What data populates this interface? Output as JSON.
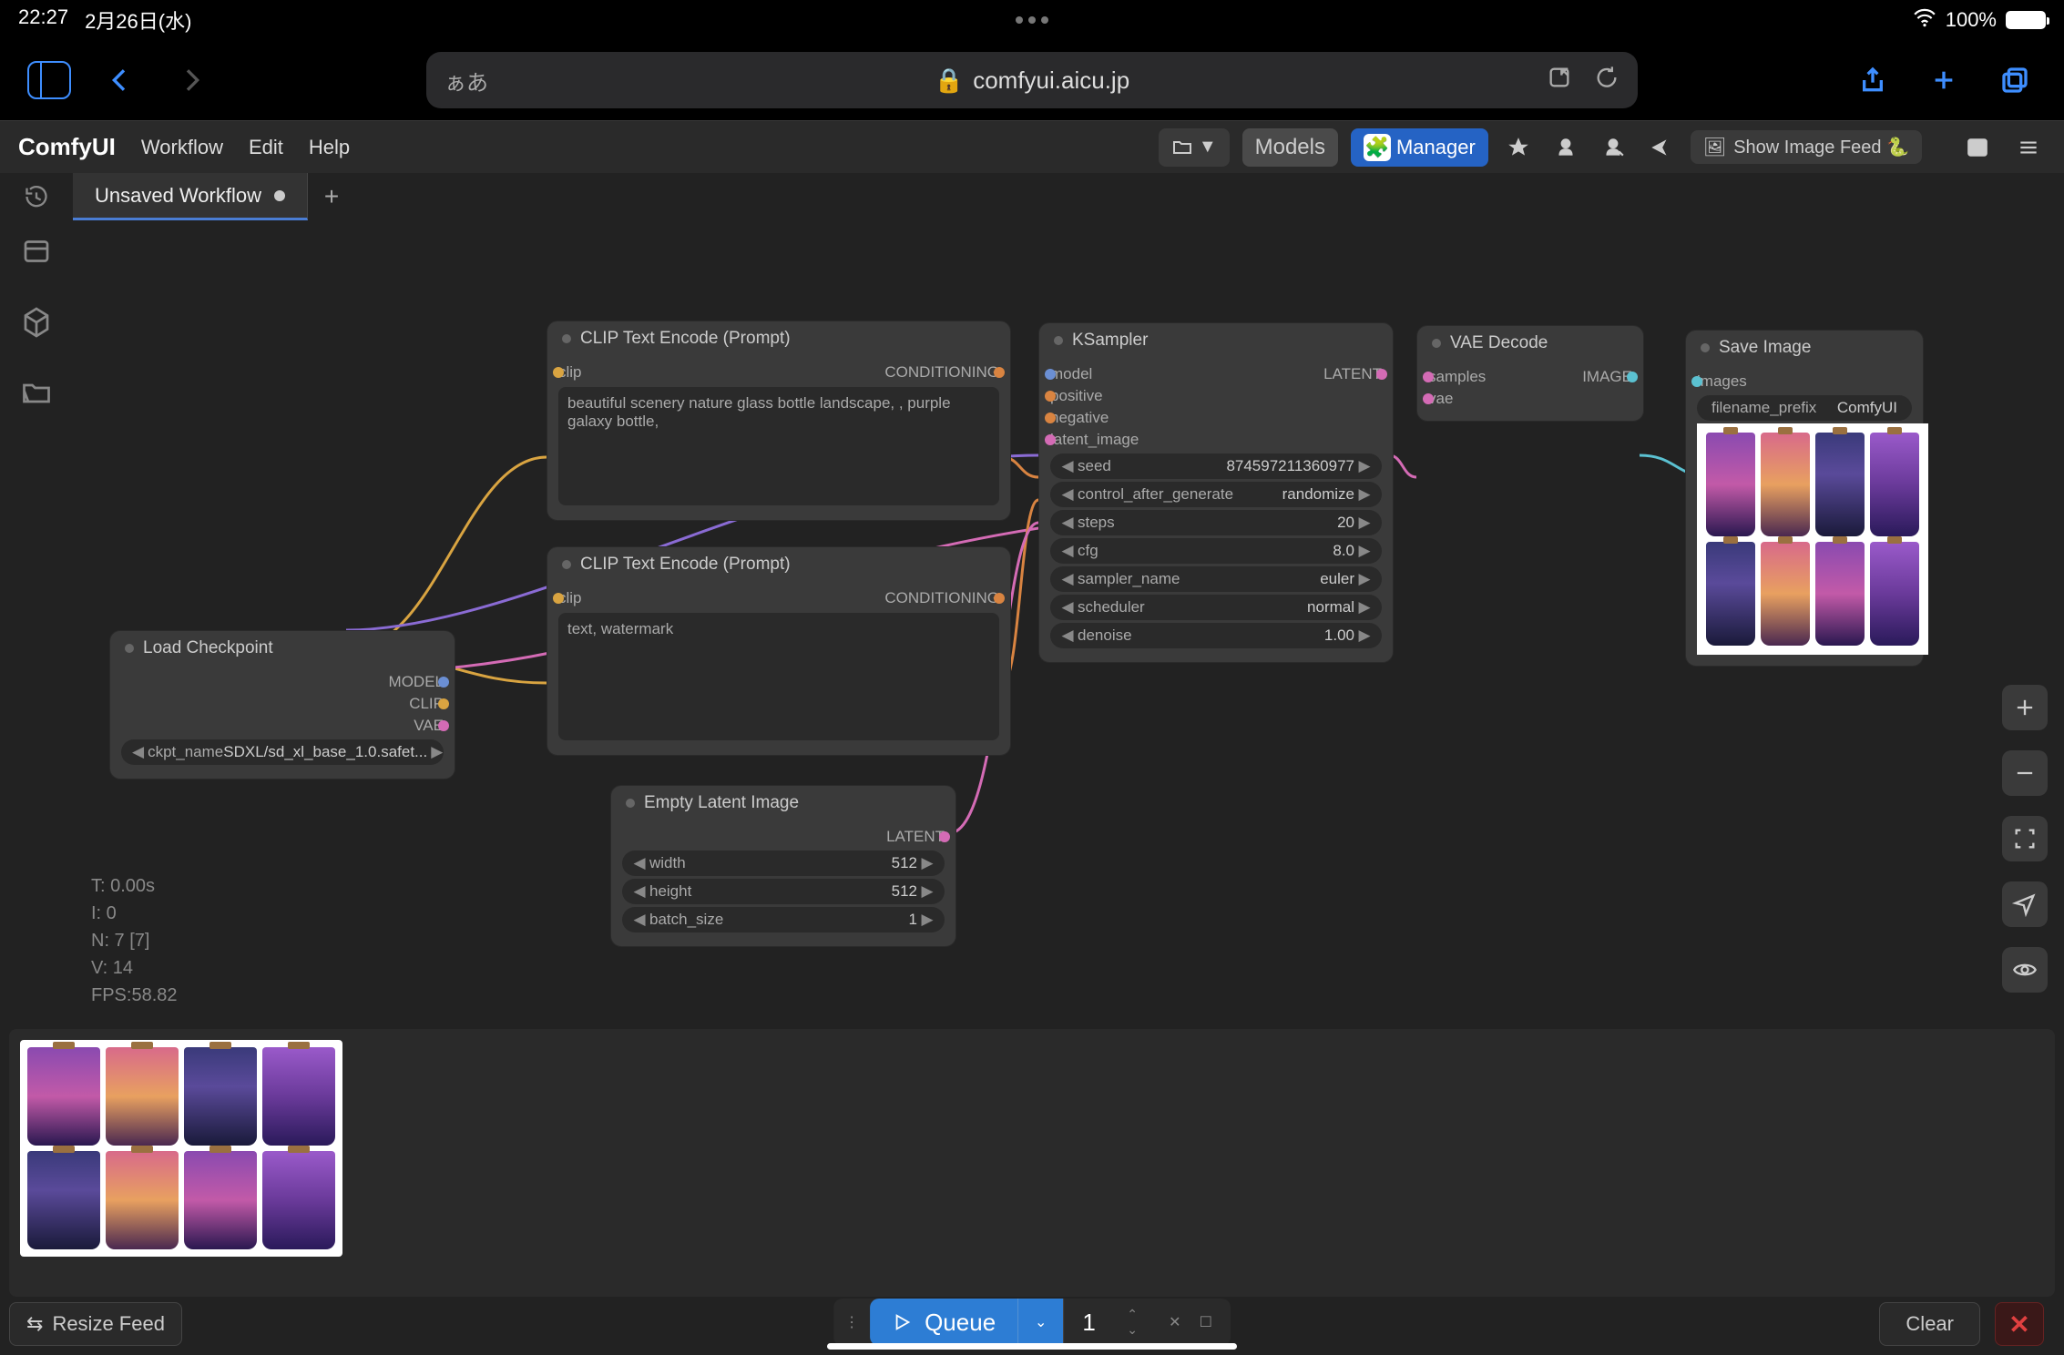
{
  "status": {
    "time": "22:27",
    "date": "2月26日(水)",
    "battery": "100%"
  },
  "browser": {
    "url": "comfyui.aicu.jp",
    "aa": "ぁあ"
  },
  "header": {
    "logo": "ComfyUI",
    "menu": [
      "Workflow",
      "Edit",
      "Help"
    ],
    "models": "Models",
    "manager": "Manager",
    "show_feed": "Show Image Feed 🐍"
  },
  "tab": {
    "title": "Unsaved Workflow"
  },
  "nodes": {
    "load_checkpoint": {
      "title": "Load Checkpoint",
      "outputs": [
        "MODEL",
        "CLIP",
        "VAE"
      ],
      "widget": {
        "name": "ckpt_name",
        "value": "SDXL/sd_xl_base_1.0.safet..."
      }
    },
    "clip1": {
      "title": "CLIP Text Encode (Prompt)",
      "input": "clip",
      "output": "CONDITIONING",
      "text": "beautiful scenery nature glass bottle landscape, , purple galaxy bottle,"
    },
    "clip2": {
      "title": "CLIP Text Encode (Prompt)",
      "input": "clip",
      "output": "CONDITIONING",
      "text": "text, watermark"
    },
    "empty_latent": {
      "title": "Empty Latent Image",
      "output": "LATENT",
      "widgets": [
        {
          "name": "width",
          "value": "512"
        },
        {
          "name": "height",
          "value": "512"
        },
        {
          "name": "batch_size",
          "value": "1"
        }
      ]
    },
    "ksampler": {
      "title": "KSampler",
      "inputs": [
        "model",
        "positive",
        "negative",
        "latent_image"
      ],
      "output": "LATENT",
      "widgets": [
        {
          "name": "seed",
          "value": "874597211360977"
        },
        {
          "name": "control_after_generate",
          "value": "randomize"
        },
        {
          "name": "steps",
          "value": "20"
        },
        {
          "name": "cfg",
          "value": "8.0"
        },
        {
          "name": "sampler_name",
          "value": "euler"
        },
        {
          "name": "scheduler",
          "value": "normal"
        },
        {
          "name": "denoise",
          "value": "1.00"
        }
      ]
    },
    "vae": {
      "title": "VAE Decode",
      "inputs": [
        "samples",
        "vae"
      ],
      "output": "IMAGE"
    },
    "save": {
      "title": "Save Image",
      "input": "images",
      "widget": {
        "name": "filename_prefix",
        "value": "ComfyUI"
      }
    }
  },
  "stats": {
    "t": "T: 0.00s",
    "i": "I: 0",
    "n": "N: 7 [7]",
    "v": "V: 14",
    "fps": "FPS:58.82"
  },
  "queue": {
    "label": "Queue",
    "count": "1"
  },
  "bottom": {
    "resize": "Resize Feed",
    "clear": "Clear"
  }
}
